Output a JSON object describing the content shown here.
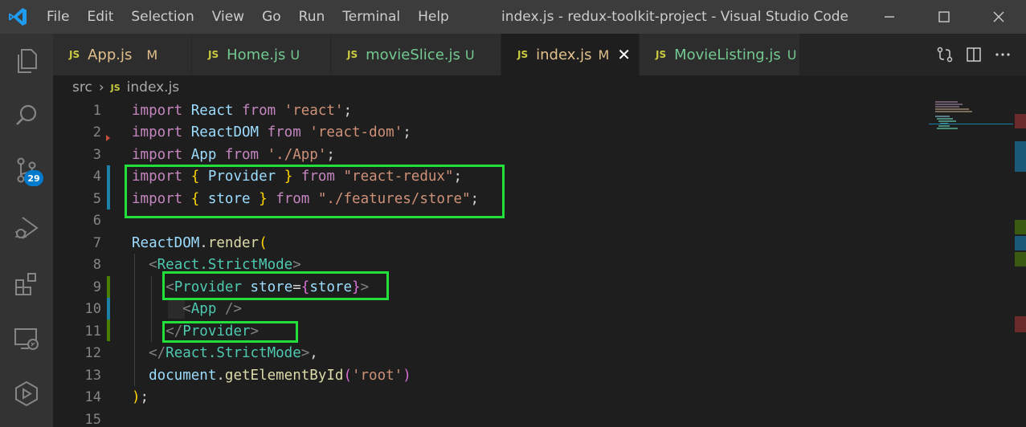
{
  "window_title": "index.js - redux-toolkit-project - Visual Studio Code",
  "menu": [
    "File",
    "Edit",
    "Selection",
    "View",
    "Go",
    "Run",
    "Terminal",
    "Help"
  ],
  "activity": {
    "source_control_badge": "29",
    "icons": [
      "explorer-icon",
      "search-icon",
      "source-control-icon",
      "run-debug-icon",
      "extensions-icon",
      "remote-explorer-icon",
      "docker-icon"
    ]
  },
  "tabs": [
    {
      "icon": "JS",
      "name": "App.js",
      "status": "M",
      "active": false
    },
    {
      "icon": "JS",
      "name": "Home.js",
      "status": "U",
      "active": false
    },
    {
      "icon": "JS",
      "name": "movieSlice.js",
      "status": "U",
      "active": false
    },
    {
      "icon": "JS",
      "name": "index.js",
      "status": "M",
      "active": true
    },
    {
      "icon": "JS",
      "name": "MovieListing.js",
      "status": "U",
      "active": false
    }
  ],
  "breadcrumb": {
    "folder": "src",
    "file_icon": "JS",
    "file": "index.js"
  },
  "lines": [
    "1",
    "2",
    "3",
    "4",
    "5",
    "6",
    "7",
    "8",
    "9",
    "10",
    "11",
    "12",
    "13",
    "14",
    "15"
  ],
  "code": {
    "l1": {
      "kw": "import",
      "id": "React",
      "from": "from",
      "str": "'react'",
      "end": ";"
    },
    "l2": {
      "kw": "import",
      "id": "ReactDOM",
      "from": "from",
      "str": "'react-dom'",
      "end": ";"
    },
    "l3": {
      "kw": "import",
      "id": "App",
      "from": "from",
      "str": "'./App'",
      "end": ";"
    },
    "l4": {
      "kw": "import",
      "open": "{",
      "id": "Provider",
      "close": "}",
      "from": "from",
      "str": "\"react-redux\"",
      "end": ";"
    },
    "l5": {
      "kw": "import",
      "open": "{",
      "id": "store",
      "close": "}",
      "from": "from",
      "str": "\"./features/store\"",
      "end": ";"
    },
    "l7": {
      "obj": "ReactDOM",
      "dot": ".",
      "fn": "render",
      "paren": "("
    },
    "l8": {
      "lt": "<",
      "tag": "React.StrictMode",
      "gt": ">"
    },
    "l9": {
      "lt": "<",
      "tag": "Provider",
      "attr": "store",
      "eq": "=",
      "open": "{",
      "val": "store",
      "close": "}",
      "gt": ">"
    },
    "l10": {
      "lt": "<",
      "tag": "App",
      "end": " />"
    },
    "l11": {
      "lt": "</",
      "tag": "Provider",
      "gt": ">"
    },
    "l12": {
      "lt": "</",
      "tag": "React.StrictMode",
      "gt": ">",
      "comma": ","
    },
    "l13": {
      "obj": "document",
      "dot": ".",
      "fn": "getElementById",
      "open": "(",
      "str": "'root'",
      "close": ")"
    },
    "l14": {
      "paren": ")",
      "end": ";"
    }
  },
  "colors": {
    "highlight": "#22e03a",
    "keyword": "#c586c0",
    "variable": "#9cdcfe",
    "string": "#ce9178",
    "tag": "#4ec9b0",
    "accent": "#007acc"
  }
}
